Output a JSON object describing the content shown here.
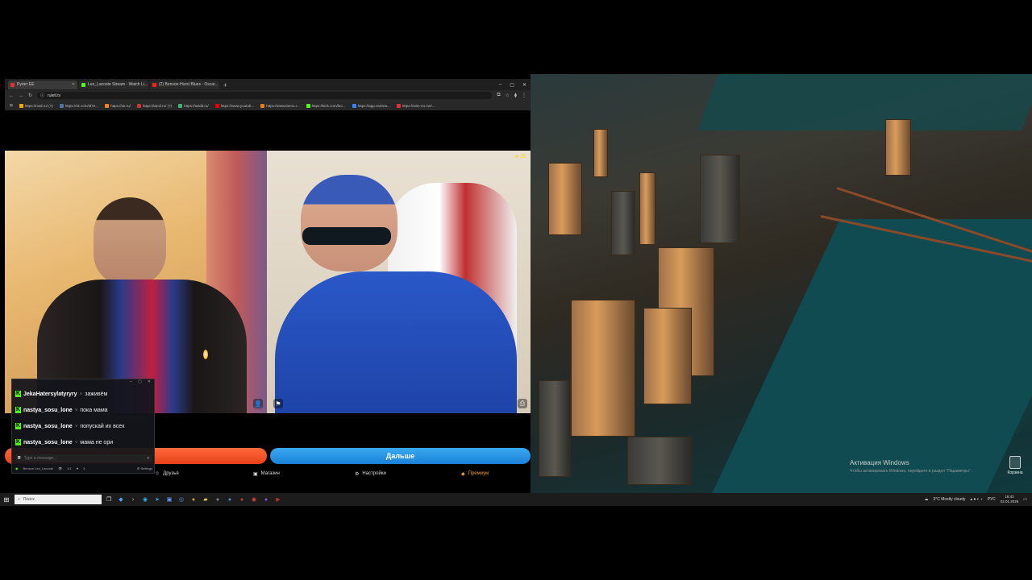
{
  "browser": {
    "tabs": [
      {
        "label": "Рулет ЕЕ",
        "color": "#e03030"
      },
      {
        "label": "Leo_Lacoste Stream - Watch Li...",
        "color": "#53fc18"
      },
      {
        "label": "(2) Benson-Hurst Blues - Oscar...",
        "color": "#ff2020"
      }
    ],
    "new_tab": "+",
    "window_controls": [
      "–",
      "▢",
      "✕"
    ],
    "url": "ruletl.tv",
    "bookmarks": [
      {
        "label": "https://mail.ru/ (?)",
        "color": "#ffa500"
      },
      {
        "label": "https://vk.com/id70...",
        "color": "#4a76a8"
      },
      {
        "label": "https://ok.ru/",
        "color": "#f58220"
      },
      {
        "label": "https://tamil.ru/ (?)",
        "color": "#c33"
      },
      {
        "label": "https://twidd.ru/",
        "color": "#3cb371"
      },
      {
        "label": "https://www.youtub...",
        "color": "#e00"
      },
      {
        "label": "https://www.itemu.r...",
        "color": "#e67e22"
      },
      {
        "label": "https://kick.com/leo...",
        "color": "#53fc18"
      },
      {
        "label": "https://app.restrea...",
        "color": "#3b82f6"
      },
      {
        "label": "https://stim-no.me/...",
        "color": "#d33"
      }
    ]
  },
  "roulette": {
    "next_label": "Дальше",
    "nav": [
      {
        "label": "Друзья",
        "icon": "friends-icon"
      },
      {
        "label": "Магазин",
        "icon": "shop-icon"
      },
      {
        "label": "Настройки",
        "icon": "gear-icon"
      },
      {
        "label": "Премиум",
        "icon": "premium-icon"
      }
    ],
    "cam_right_badge": "25"
  },
  "chat": {
    "messages": [
      {
        "user": "JekaHatersylatyryry",
        "text": "заживём"
      },
      {
        "user": "nastya_sosu_lone",
        "text": "пока мама"
      },
      {
        "user": "nastya_sosu_lone",
        "text": "попускай их всех"
      },
      {
        "user": "nastya_sosu_lone",
        "text": "мама не ори"
      }
    ],
    "input_placeholder": "Type a message...",
    "footer": {
      "channel": "Benson Leo_Lacoste",
      "viewers": "1/1",
      "likes": "3",
      "settings": "Settings"
    }
  },
  "desktop": {
    "activation_title": "Активация Windows",
    "activation_sub": "Чтобы активировать Windows, перейдите в раздел \"Параметры\".",
    "recycle_label": "Корзина"
  },
  "taskbar": {
    "search_placeholder": "Поиск",
    "weather": "3°C  Mostly cloudy",
    "lang": "РУС",
    "time": "16:42",
    "date": "02.01.2026"
  },
  "colors": {
    "kick_green": "#53fc18",
    "stop_orange": "#f05020",
    "next_blue": "#2a96e6"
  }
}
